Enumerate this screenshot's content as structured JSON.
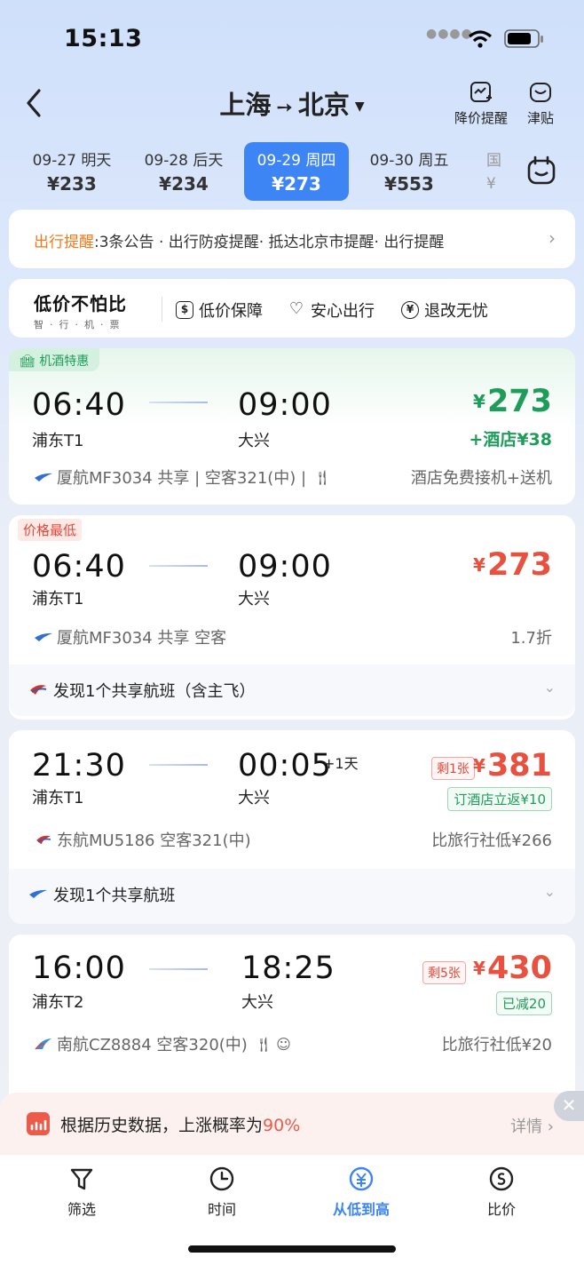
{
  "status": {
    "time": "15:13"
  },
  "header": {
    "origin": "上海",
    "destination": "北京",
    "price_alert_label": "降价提醒",
    "subsidy_label": "津贴"
  },
  "dates": [
    {
      "date": "09-27 明天",
      "price": "¥233"
    },
    {
      "date": "09-28 后天",
      "price": "¥234"
    },
    {
      "date": "09-29 周四",
      "price": "¥273",
      "active": true
    },
    {
      "date": "09-30 周五",
      "price": "¥553"
    },
    {
      "date": "国",
      "price": "¥"
    }
  ],
  "notice": {
    "label": "出行提醒",
    "text": ":3条公告 · 出行防疫提醒· 抵达北京市提醒· 出行提醒"
  },
  "guarantee": {
    "brand": "低价不怕比",
    "brand_sub": "智·行·机·票",
    "items": [
      "低价保障",
      "安心出行",
      "退改无忧"
    ]
  },
  "flights": [
    {
      "badge": "机酒特惠",
      "dep_time": "06:40",
      "dep_airport": "浦东T1",
      "arr_time": "09:00",
      "arr_airport": "大兴",
      "price": "273",
      "price_symbol": "¥",
      "extra": "+酒店¥38",
      "info": "厦航MF3034 共享 | 空客321(中) |",
      "note": "酒店免费接机+送机"
    },
    {
      "badge": "价格最低",
      "dep_time": "06:40",
      "dep_airport": "浦东T1",
      "arr_time": "09:00",
      "arr_airport": "大兴",
      "price": "273",
      "price_symbol": "¥",
      "info": "厦航MF3034 共享 空客",
      "note": "1.7折",
      "share": "发现1个共享航班（含主飞）"
    },
    {
      "dep_time": "21:30",
      "dep_airport": "浦东T1",
      "arr_time": "00:05",
      "arr_suffix": "+1天",
      "arr_airport": "大兴",
      "price": "381",
      "price_symbol": "¥",
      "remain": "剩1张",
      "promo": "订酒店立返¥10",
      "info": "东航MU5186 空客321(中)",
      "note": "比旅行社低¥266",
      "share": "发现1个共享航班"
    },
    {
      "dep_time": "16:00",
      "dep_airport": "浦东T2",
      "arr_time": "18:25",
      "arr_airport": "大兴",
      "price": "430",
      "price_symbol": "¥",
      "remain": "剩5张",
      "promo": "已减20",
      "info": "南航CZ8884 空客320(中)",
      "note": "比旅行社低¥20"
    }
  ],
  "prediction": {
    "text": "根据历史数据，上涨概率为",
    "percent": "90%",
    "detail": "详情"
  },
  "nav": [
    {
      "label": "筛选",
      "icon": "filter-icon"
    },
    {
      "label": "时间",
      "icon": "clock-icon"
    },
    {
      "label": "从低到高",
      "icon": "yuan-sort-icon",
      "active": true
    },
    {
      "label": "比价",
      "icon": "compare-price-icon"
    }
  ],
  "colors": {
    "accent": "#3d84f5",
    "price_red": "#e8513f",
    "price_green": "#1e9d5a",
    "orange": "#f07a1a"
  }
}
